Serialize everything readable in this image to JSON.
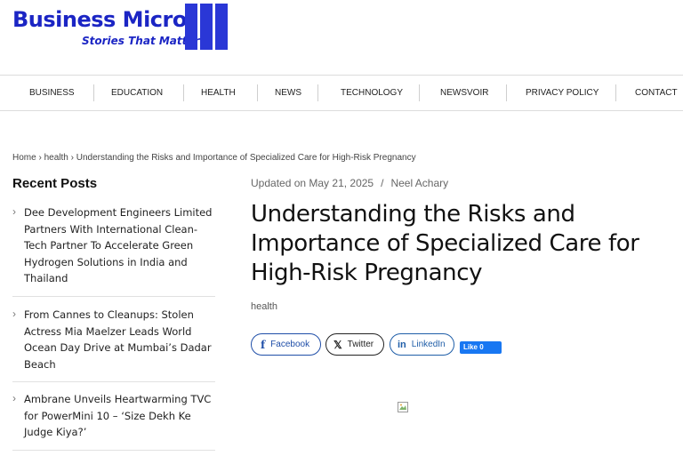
{
  "logo": {
    "title": "Business Micro",
    "subtitle": "Stories That Matter"
  },
  "nav": {
    "items": [
      "BUSINESS",
      "EDUCATION",
      "HEALTH",
      "NEWS",
      "TECHNOLOGY",
      "NEWSVOIR",
      "PRIVACY POLICY",
      "CONTACT"
    ]
  },
  "breadcrumb": {
    "home": "Home",
    "sep": " › ",
    "category": "health",
    "current": "Understanding the Risks and Importance of Specialized Care for High-Risk Pregnancy"
  },
  "sidebar": {
    "title": "Recent Posts",
    "posts": [
      "Dee Development Engineers Limited Partners With International Clean-Tech Partner To Accelerate Green Hydrogen Solutions in India and Thailand",
      "From Cannes to Cleanups: Stolen Actress Mia Maelzer Leads World Ocean Day Drive at Mumbai’s Dadar Beach",
      "Ambrane Unveils Heartwarming TVC for PowerMini 10 – ‘Size Dekh Ke Judge Kiya?’"
    ]
  },
  "article": {
    "updated": "Updated on May 21, 2025",
    "author": "Neel Achary",
    "title": "Understanding the Risks and Importance of Specialized Care for High-Risk Pregnancy",
    "category": "health"
  },
  "share": {
    "facebook": "Facebook",
    "twitter": "Twitter",
    "linkedin": "LinkedIn",
    "like": "Like 0"
  },
  "colors": {
    "brand": "#1b25c4",
    "facebook": "#1f4ea8",
    "like": "#1877f2"
  }
}
